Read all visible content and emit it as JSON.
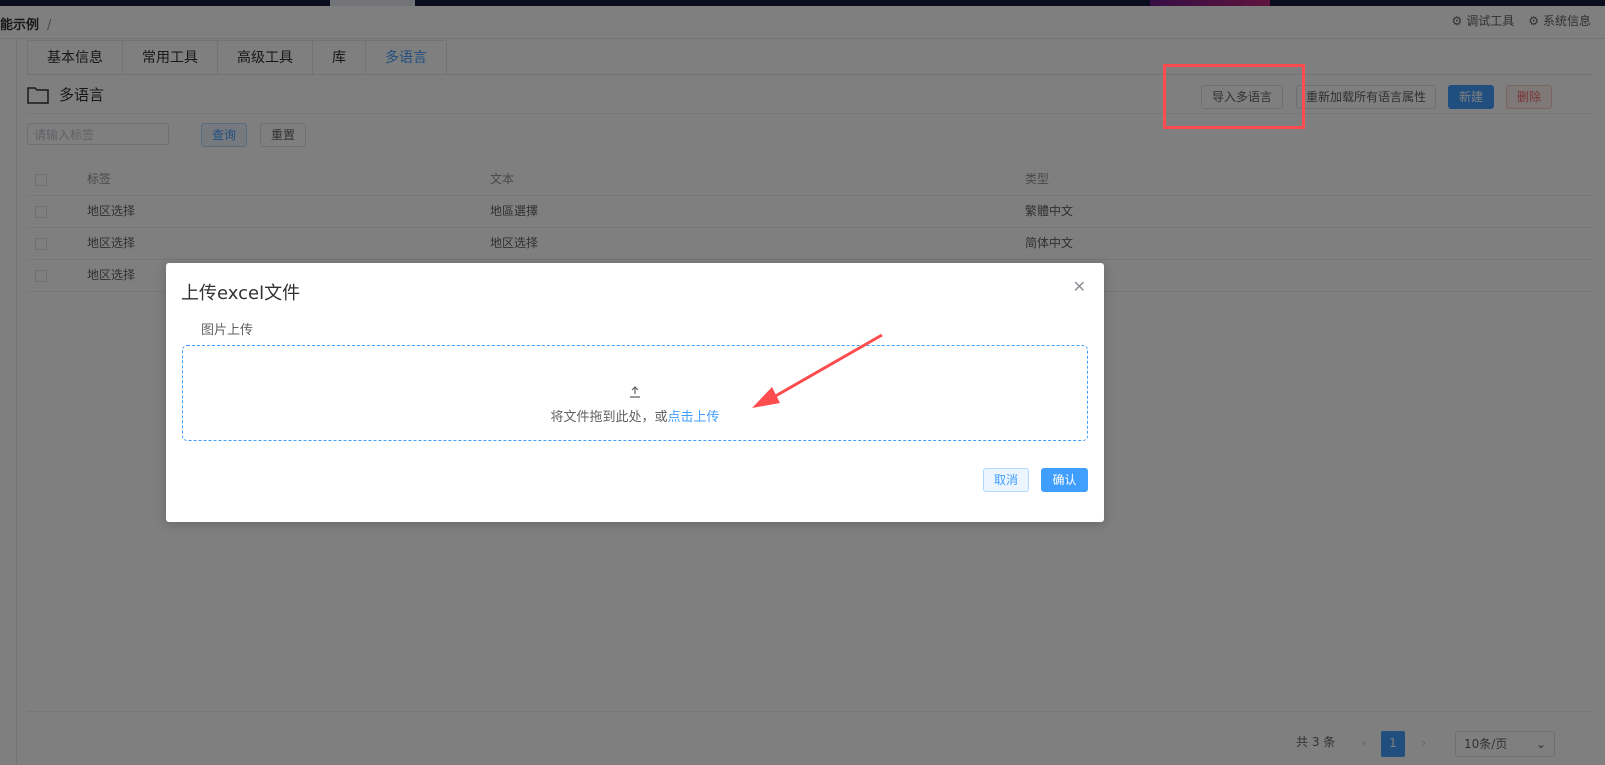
{
  "topbar": {
    "breadcrumb": "能示例",
    "breadcrumb_sep": "/",
    "debug_tool": "调试工具",
    "system_info": "系统信息"
  },
  "tabs": [
    {
      "label": "基本信息"
    },
    {
      "label": "常用工具"
    },
    {
      "label": "高级工具"
    },
    {
      "label": "库"
    },
    {
      "label": "多语言",
      "active": true
    }
  ],
  "section": {
    "title": "多语言",
    "import_button": "导入多语言",
    "reload_button": "重新加载所有语言属性",
    "new_button": "新建",
    "delete_button": "删除"
  },
  "search": {
    "placeholder": "请输入标签",
    "query_button": "查询",
    "reset_button": "重置"
  },
  "table": {
    "columns": [
      "标签",
      "文本",
      "类型"
    ],
    "rows": [
      [
        "地区选择",
        "地區選擇",
        "繁體中文"
      ],
      [
        "地区选择",
        "地区选择",
        "简体中文"
      ],
      [
        "地区选择",
        "",
        ""
      ]
    ]
  },
  "pager": {
    "total": "共 3 条",
    "current_page": "1",
    "page_size": "10条/页"
  },
  "dialog": {
    "title": "上传excel文件",
    "field_label": "图片上传",
    "drop_text": "将文件拖到此处，或",
    "drop_link": "点击上传",
    "cancel": "取消",
    "confirm": "确认"
  },
  "colors": {
    "primary": "#409eff",
    "danger": "#f56c6c",
    "annotation": "#ff4d4f"
  }
}
